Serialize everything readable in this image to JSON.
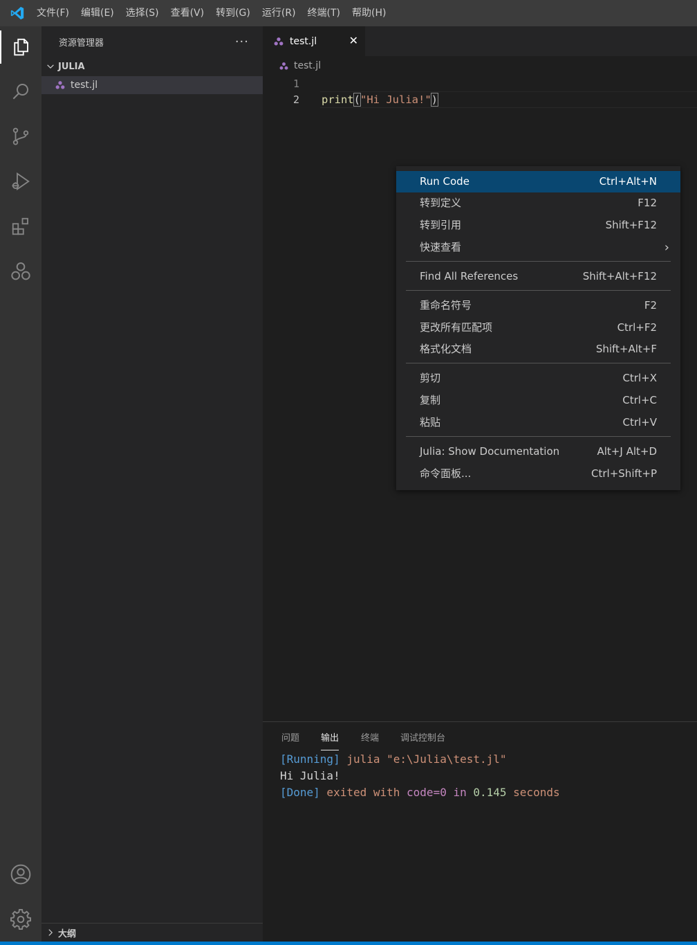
{
  "menu": [
    "文件(F)",
    "编辑(E)",
    "选择(S)",
    "查看(V)",
    "转到(G)",
    "运行(R)",
    "终端(T)",
    "帮助(H)"
  ],
  "sidebar": {
    "title": "资源管理器",
    "more": "···",
    "folder": "JULIA",
    "file": "test.jl",
    "outline": "大纲"
  },
  "editor": {
    "tab_label": "test.jl",
    "close_glyph": "✕",
    "breadcrumb": "test.jl",
    "lines": [
      {
        "number": "1",
        "fn": "",
        "open": "",
        "str": "",
        "close": ""
      },
      {
        "number": "2",
        "fn": "print",
        "open": "(",
        "str": "\"Hi Julia!\"",
        "close": ")"
      }
    ]
  },
  "context_menu": {
    "items": [
      {
        "label": "Run Code",
        "key": "Ctrl+Alt+N"
      },
      {
        "label": "转到定义",
        "key": "F12"
      },
      {
        "label": "转到引用",
        "key": "Shift+F12"
      },
      {
        "label": "快速查看",
        "key": "›"
      },
      {
        "label": "Find All References",
        "key": "Shift+Alt+F12"
      },
      {
        "label": "重命名符号",
        "key": "F2"
      },
      {
        "label": "更改所有匹配项",
        "key": "Ctrl+F2"
      },
      {
        "label": "格式化文档",
        "key": "Shift+Alt+F"
      },
      {
        "label": "剪切",
        "key": "Ctrl+X"
      },
      {
        "label": "复制",
        "key": "Ctrl+C"
      },
      {
        "label": "粘贴",
        "key": "Ctrl+V"
      },
      {
        "label": "Julia: Show Documentation",
        "key": "Alt+J Alt+D"
      },
      {
        "label": "命令面板...",
        "key": "Ctrl+Shift+P"
      }
    ]
  },
  "panel": {
    "tabs": [
      "问题",
      "输出",
      "终端",
      "调试控制台"
    ],
    "output": {
      "l1_tag": "[Running]",
      "l1_cmd": " julia \"e:\\Julia\\test.jl\"",
      "l2": "Hi Julia!",
      "l3_tag": "[Done]",
      "l3_a": " exited with ",
      "l3_code": "code=0",
      "l3_in": " in ",
      "l3_num": "0.145",
      "l3_unit": " seconds"
    }
  },
  "colors": {
    "accent": "#007acc",
    "selection": "#094771",
    "julia_purple": "#a074c4"
  }
}
